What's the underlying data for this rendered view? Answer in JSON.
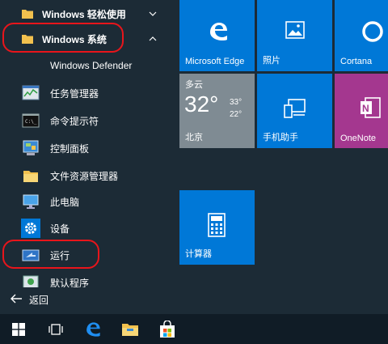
{
  "app_list": {
    "items": [
      {
        "label": "Windows 轻松使用",
        "icon": "folder-icon"
      },
      {
        "label": "Windows 系统",
        "icon": "folder-icon"
      },
      {
        "label": "Windows Defender",
        "icon": "none"
      },
      {
        "label": "任务管理器",
        "icon": "task-manager-icon"
      },
      {
        "label": "命令提示符",
        "icon": "command-prompt-icon"
      },
      {
        "label": "控制面板",
        "icon": "control-panel-icon"
      },
      {
        "label": "文件资源管理器",
        "icon": "file-explorer-icon"
      },
      {
        "label": "此电脑",
        "icon": "this-pc-icon"
      },
      {
        "label": "设备",
        "icon": "gear-icon"
      },
      {
        "label": "运行",
        "icon": "run-icon"
      },
      {
        "label": "默认程序",
        "icon": "default-programs-icon"
      }
    ],
    "back_label": "返回"
  },
  "tiles": {
    "edge": "Microsoft Edge",
    "photos": "照片",
    "cortana": "Cortana",
    "weather": {
      "condition": "多云",
      "temp": "32°",
      "high": "33°",
      "low": "22°",
      "city": "北京"
    },
    "phone": "手机助手",
    "onenote": "OneNote",
    "calculator": "计算器"
  },
  "colors": {
    "tile_blue": "#0078d7",
    "onenote_purple": "#a4378f",
    "weather_bg": "#7f8b93",
    "highlight_red": "#e8151b",
    "start_bg": "#1c2b36",
    "taskbar_bg": "#101c26"
  },
  "taskbar": [
    "windows-start-icon",
    "task-view-icon",
    "edge-icon",
    "file-explorer-icon",
    "store-icon"
  ]
}
